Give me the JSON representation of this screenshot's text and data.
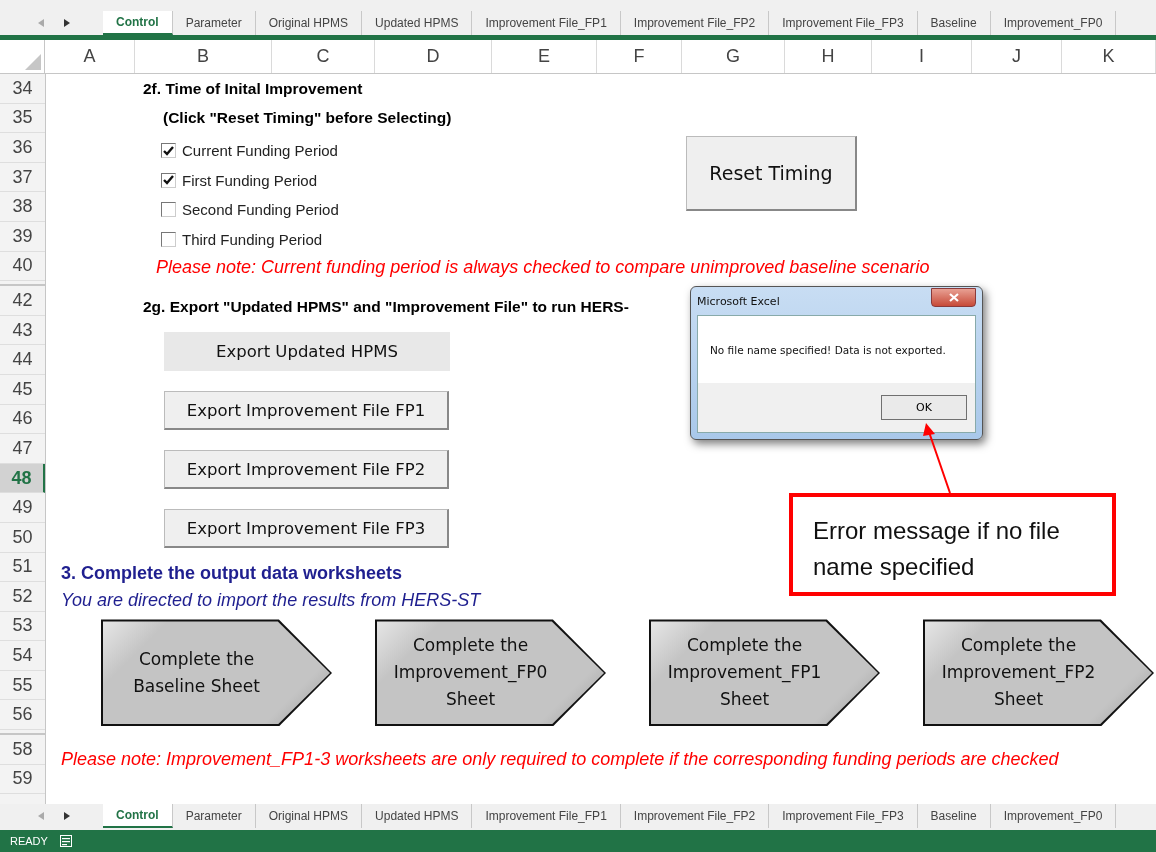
{
  "top_sheet_tabs": [
    {
      "label": "Control",
      "selected": true
    },
    {
      "label": "Parameter",
      "selected": false
    },
    {
      "label": "Original HPMS",
      "selected": false
    },
    {
      "label": "Updated HPMS",
      "selected": false
    },
    {
      "label": "Improvement File_FP1",
      "selected": false
    },
    {
      "label": "Improvement File_FP2",
      "selected": false
    },
    {
      "label": "Improvement File_FP3",
      "selected": false
    },
    {
      "label": "Baseline",
      "selected": false
    },
    {
      "label": "Improvement_FP0",
      "selected": false
    }
  ],
  "columns": [
    "A",
    "B",
    "C",
    "D",
    "E",
    "F",
    "G",
    "H",
    "I",
    "J",
    "K"
  ],
  "row_groups": [
    [
      {
        "label": "34",
        "selected": false
      },
      {
        "label": "35",
        "selected": false
      },
      {
        "label": "36",
        "selected": false
      },
      {
        "label": "37",
        "selected": false
      },
      {
        "label": "38",
        "selected": false
      },
      {
        "label": "39",
        "selected": false
      },
      {
        "label": "40",
        "selected": false
      }
    ],
    [
      {
        "label": "42",
        "selected": false
      },
      {
        "label": "43",
        "selected": false
      },
      {
        "label": "44",
        "selected": false
      },
      {
        "label": "45",
        "selected": false
      },
      {
        "label": "46",
        "selected": false
      },
      {
        "label": "47",
        "selected": false
      },
      {
        "label": "48",
        "selected": true
      },
      {
        "label": "49",
        "selected": false
      },
      {
        "label": "50",
        "selected": false
      },
      {
        "label": "51",
        "selected": false
      },
      {
        "label": "52",
        "selected": false
      },
      {
        "label": "53",
        "selected": false
      },
      {
        "label": "54",
        "selected": false
      },
      {
        "label": "55",
        "selected": false
      },
      {
        "label": "56",
        "selected": false
      }
    ],
    [
      {
        "label": "58",
        "selected": false
      },
      {
        "label": "59",
        "selected": false
      }
    ]
  ],
  "timing": {
    "heading": "2f. Time of Inital Improvement",
    "subheading": "(Click \"Reset Timing\" before Selecting)",
    "checkboxes": [
      {
        "label": "Current Funding Period",
        "checked": true
      },
      {
        "label": "First Funding Period",
        "checked": true
      },
      {
        "label": "Second Funding Period",
        "checked": false
      },
      {
        "label": "Third Funding Period",
        "checked": false
      }
    ],
    "reset_button": "Reset Timing",
    "note": "Please note: Current funding period is always checked to compare unimproved baseline scenario"
  },
  "export": {
    "heading": "2g. Export \"Updated HPMS\" and \"Improvement File\" to run HERS-",
    "buttons": [
      {
        "label": "Export Updated HPMS",
        "kind": "flat"
      },
      {
        "label": "Export Improvement File FP1",
        "kind": "raised"
      },
      {
        "label": "Export Improvement File FP2",
        "kind": "raised"
      },
      {
        "label": "Export Improvement File FP3",
        "kind": "raised"
      }
    ]
  },
  "output": {
    "heading": "3. Complete the output data worksheets",
    "subheading": "You are directed to import the results from HERS-ST",
    "arrow_buttons": [
      [
        "Complete the",
        "Baseline Sheet"
      ],
      [
        "Complete the",
        "Improvement_FP0",
        "Sheet"
      ],
      [
        "Complete the",
        "Improvement_FP1",
        "Sheet"
      ],
      [
        "Complete the",
        "Improvement_FP2",
        "Sheet"
      ]
    ],
    "note": "Please note: Improvement_FP1-3 worksheets are only required to complete if the corresponding funding periods are checked"
  },
  "dialog": {
    "title": "Microsoft Excel",
    "message": "No file name specified! Data is not exported.",
    "button": "OK"
  },
  "callout": {
    "text": "Error message if no file name specified"
  },
  "sheet_tabs": [
    {
      "label": "Control",
      "selected": true
    },
    {
      "label": "Parameter",
      "selected": false
    },
    {
      "label": "Original HPMS",
      "selected": false
    },
    {
      "label": "Updated HPMS",
      "selected": false
    },
    {
      "label": "Improvement File_FP1",
      "selected": false
    },
    {
      "label": "Improvement File_FP2",
      "selected": false
    },
    {
      "label": "Improvement File_FP3",
      "selected": false
    },
    {
      "label": "Baseline",
      "selected": false
    },
    {
      "label": "Improvement_FP0",
      "selected": false
    }
  ],
  "status_bar": {
    "status": "READY"
  }
}
